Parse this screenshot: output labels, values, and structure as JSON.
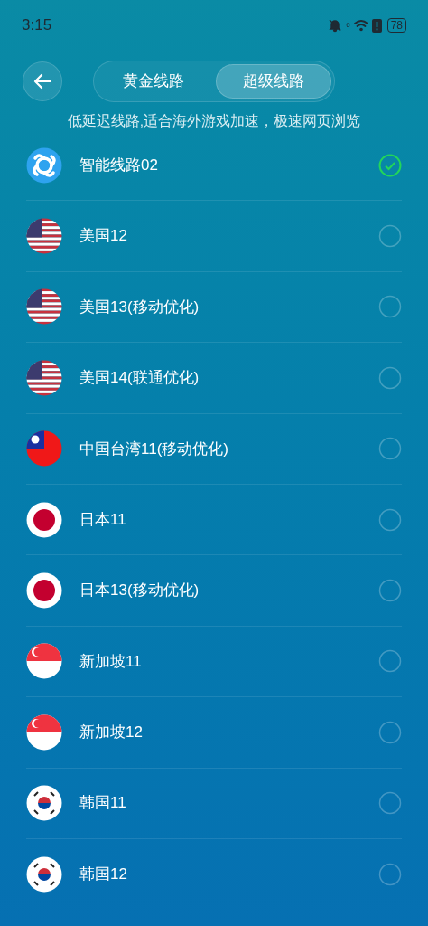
{
  "status_bar": {
    "time": "3:15",
    "wifi_generation": "6",
    "battery": "78"
  },
  "tabs": [
    {
      "label": "黄金线路",
      "selected": false
    },
    {
      "label": "超级线路",
      "selected": true
    }
  ],
  "description": "低延迟线路,适合海外游戏加速，极速网页浏览",
  "routes": [
    {
      "name": "智能线路02",
      "kind": "smart",
      "selected": true
    },
    {
      "name": "美国12",
      "kind": "us",
      "selected": false
    },
    {
      "name": "美国13(移动优化)",
      "kind": "us",
      "selected": false
    },
    {
      "name": "美国14(联通优化)",
      "kind": "us",
      "selected": false
    },
    {
      "name": "中国台湾11(移动优化)",
      "kind": "tw",
      "selected": false
    },
    {
      "name": "日本11",
      "kind": "jp",
      "selected": false
    },
    {
      "name": "日本13(移动优化)",
      "kind": "jp",
      "selected": false
    },
    {
      "name": "新加坡11",
      "kind": "sg",
      "selected": false
    },
    {
      "name": "新加坡12",
      "kind": "sg",
      "selected": false
    },
    {
      "name": "韩国11",
      "kind": "kr",
      "selected": false
    },
    {
      "name": "韩国12",
      "kind": "kr",
      "selected": false
    }
  ]
}
